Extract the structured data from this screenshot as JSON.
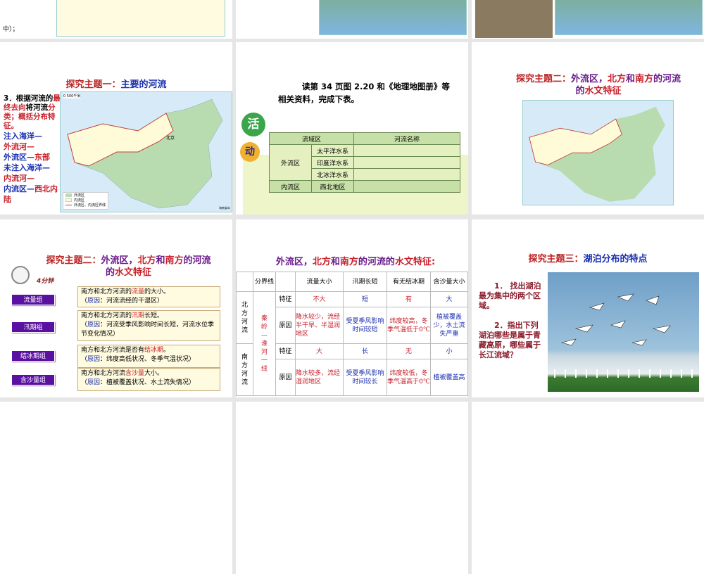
{
  "slides_row0": {
    "s1_text": "中）；"
  },
  "slide_rivers": {
    "title_prefix": "探究主题一：",
    "title_main": "主要的河流",
    "q_num": "3．根据河流的",
    "q_red1": "最终去向",
    "q_mid": "将河流",
    "q_red2": "分类；概括分布特征。",
    "l1": "注入海洋—",
    "l2": "外流河—",
    "l3a": "外流区—",
    "l3b": "东部",
    "l4": "未注入海洋—",
    "l5": "内流河—",
    "l6a": "内流区—",
    "l6b": "西北内陆",
    "map": {
      "scale": "0      500千米",
      "capital": "北京",
      "legend": [
        "外流区",
        "内流区",
        "外流区、内流区界线"
      ],
      "publisher": "海南省岛"
    }
  },
  "slide_activity": {
    "intro": "读第 34 页图 2.20 和《地理地图册》等相关资料，完成下表。",
    "badge1": "活",
    "badge2": "动",
    "headers": [
      "流域区",
      "河流名称"
    ],
    "outflow": "外流区",
    "inflow": "内流区",
    "systems": [
      "太平洋水系",
      "印度洋水系",
      "北冰洋水系",
      "西北地区"
    ]
  },
  "slide_theme2_map": {
    "title_a": "探究主题二：",
    "title_b": "外流区，",
    "title_c": "北方",
    "title_d": "和",
    "title_e": "南方",
    "title_f": "的河流",
    "title_g": "的",
    "title_h": "水文特征"
  },
  "slide_groups": {
    "timer": "4分钟",
    "groups": [
      {
        "label": "流量组",
        "l1a": "南方和北方河流的",
        "key": "流量",
        "l1b": "的大小。",
        "reason": "原因",
        "r": "：河流流经的干湿区）"
      },
      {
        "label": "汛期组",
        "l1a": "南方和北方河流的",
        "key": "汛期",
        "l1b": "长短。",
        "reason": "原因",
        "r": "：河流受季风影响时间长短，河流水位季节变化情况）"
      },
      {
        "label": "结冰期组",
        "l1a": "南方和北方河流是否有",
        "key": "结冰期",
        "l1b": "。",
        "reason": "原因",
        "r": "：纬度高低状况、冬季气温状况）"
      },
      {
        "label": "含沙量组",
        "l1a": "南方和北方河流",
        "key": "含沙量",
        "l1b": "大小。",
        "reason": "原因",
        "r": "：植被覆盖状况、水土流失情况）"
      }
    ]
  },
  "slide_table": {
    "title_a": "外流区，",
    "title_b": "北方",
    "title_c": "和",
    "title_d": "南方",
    "title_e": "的河流的",
    "title_f": "水文特征:",
    "headers": [
      "分界线",
      "流量大小",
      "汛期长短",
      "有无结冰期",
      "含沙量大小"
    ],
    "north": "北方河流",
    "south": "南方河流",
    "divider": "秦岭—淮河一线",
    "feature": "特征",
    "cause": "原因",
    "north_feat": [
      "不大",
      "短",
      "有",
      "大"
    ],
    "north_cause": [
      "降水较少，流经半干旱、半湿润地区",
      "受夏季风影响时间较短",
      "纬度较高，冬季气温低于0℃",
      "植被覆盖少，水土流失严重"
    ],
    "south_feat": [
      "大",
      "长",
      "无",
      "小"
    ],
    "south_cause": [
      "降水较多，流经湿润地区",
      "受夏季风影响时间较长",
      "纬度较低，冬季气温高于0℃",
      "植被覆盖高"
    ]
  },
  "slide_lakes": {
    "title_a": "探究主题三：",
    "title_b": "湖泊分布的特点",
    "q1": "1． 找出湖泊最为集中的两个区域。",
    "q2": "2．指出下列湖泊哪些是属于青藏高原，哪些属于长江流域？"
  }
}
